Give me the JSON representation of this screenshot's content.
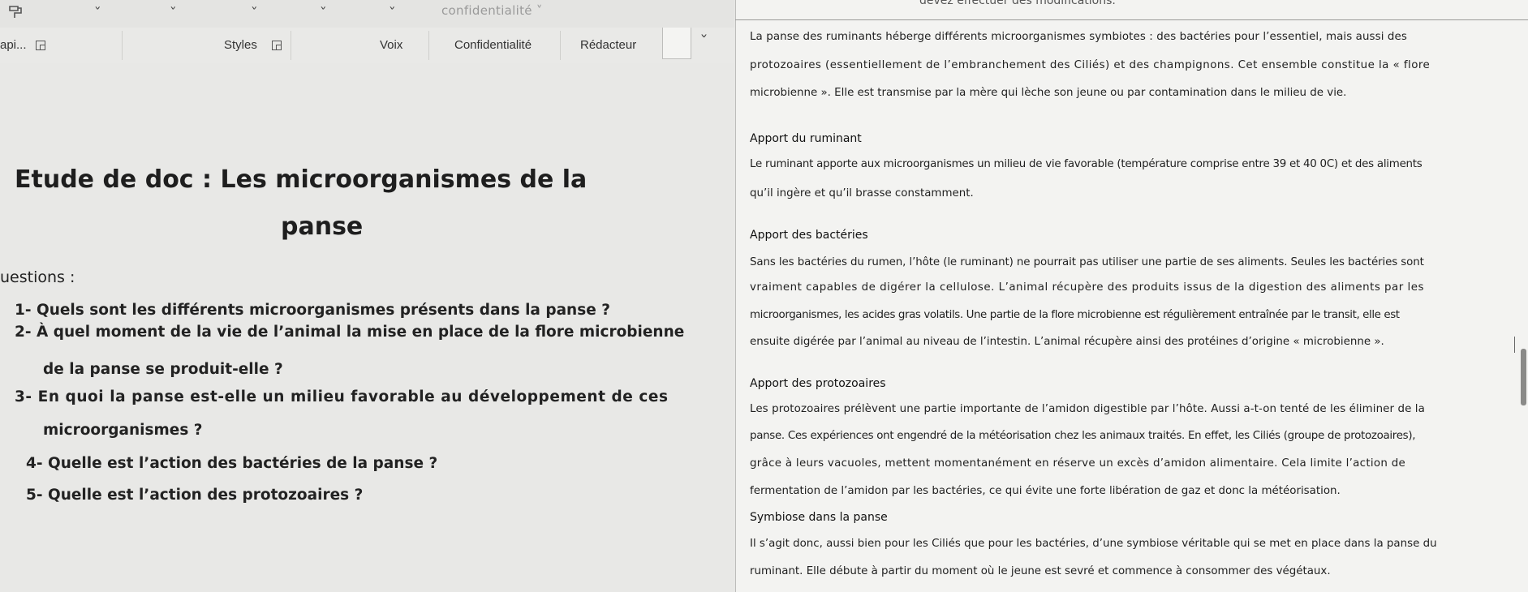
{
  "ribbon": {
    "top_label": "confidentialité ˅",
    "groups": [
      "api...",
      "Styles",
      "Voix",
      "Confidentialité",
      "Rédacteur"
    ],
    "chevron": "˅"
  },
  "slide": {
    "title_line1": "Etude de doc : Les microorganismes de la",
    "title_line2": "panse",
    "questions_heading": "uestions :",
    "questions": [
      "1-  Quels sont les différents microorganismes présents dans la panse ?",
      "2-  À quel moment de la vie de l’animal la mise en place de la flore microbienne",
      "de la panse se produit-elle ?",
      "3-  En quoi la panse est-elle un milieu favorable au développement de ces",
      "microorganismes ?",
      "4-  Quelle est l’action des bactéries de la panse ?",
      "5-  Quelle est l’action des protozoaires ?"
    ]
  },
  "document": {
    "top_message": "devez effectuer des modifications.",
    "intro": [
      "La panse des ruminants héberge différents microorganismes symbiotes : des bactéries pour l’essentiel, mais aussi des",
      "protozoaires (essentiellement de l’embranchement des Ciliés) et des champignons. Cet ensemble constitue la « flore",
      "microbienne ». Elle est transmise par la mère qui lèche son jeune ou par contamination dans le milieu de vie."
    ],
    "h_ruminant": "Apport du ruminant",
    "ruminant": [
      "Le ruminant apporte aux microorganismes un milieu de vie favorable (température comprise entre 39 et 40 0C) et des aliments",
      "qu’il ingère et qu’il brasse constamment."
    ],
    "h_bacteries": "Apport des bactéries",
    "bacteries": [
      "Sans les bactéries du rumen, l’hôte (le ruminant) ne pourrait pas utiliser une partie de ses aliments. Seules les bactéries sont",
      "vraiment capables de digérer la cellulose. L’animal récupère des produits issus de la digestion des aliments par les",
      "microorganismes, les acides gras volatils. Une partie de la flore microbienne est régulièrement entraînée par le transit, elle est",
      "ensuite digérée par l’animal au niveau de l’intestin. L’animal récupère ainsi des protéines d’origine « microbienne »."
    ],
    "h_protozoaires": "Apport des protozoaires",
    "protozoaires": [
      "Les protozoaires prélèvent une partie importante de l’amidon digestible par l’hôte. Aussi a-t-on tenté de les éliminer de la",
      "panse. Ces expériences ont engendré de la météorisation chez les animaux traités. En effet, les Ciliés (groupe de protozoaires),",
      "grâce à leurs vacuoles, mettent momentanément en réserve un excès d’amidon alimentaire. Cela limite l’action de",
      "fermentation de l’amidon par les bactéries, ce qui évite une forte libération de gaz et donc la météorisation."
    ],
    "h_symbiose": "Symbiose dans la panse",
    "symbiose": [
      "Il s’agit donc, aussi bien pour les Ciliés que pour les bactéries, d’une symbiose véritable qui se met en place dans la panse du",
      "ruminant. Elle débute à partir du moment où le jeune est sevré et commence à consommer des végétaux."
    ]
  }
}
